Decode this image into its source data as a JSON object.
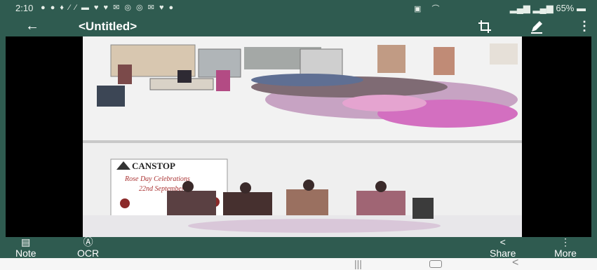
{
  "status_bar": {
    "time": "2:10",
    "battery": "65%"
  },
  "app_bar": {
    "title": "<Untitled>"
  },
  "bottom_bar": {
    "note_label": "Note",
    "ocr_label": "OCR",
    "share_label": "Share",
    "more_label": "More"
  },
  "photo": {
    "banner_brand": "CANSTOP",
    "banner_line1": "Rose Day Celebrations",
    "banner_line2": "22nd September"
  }
}
